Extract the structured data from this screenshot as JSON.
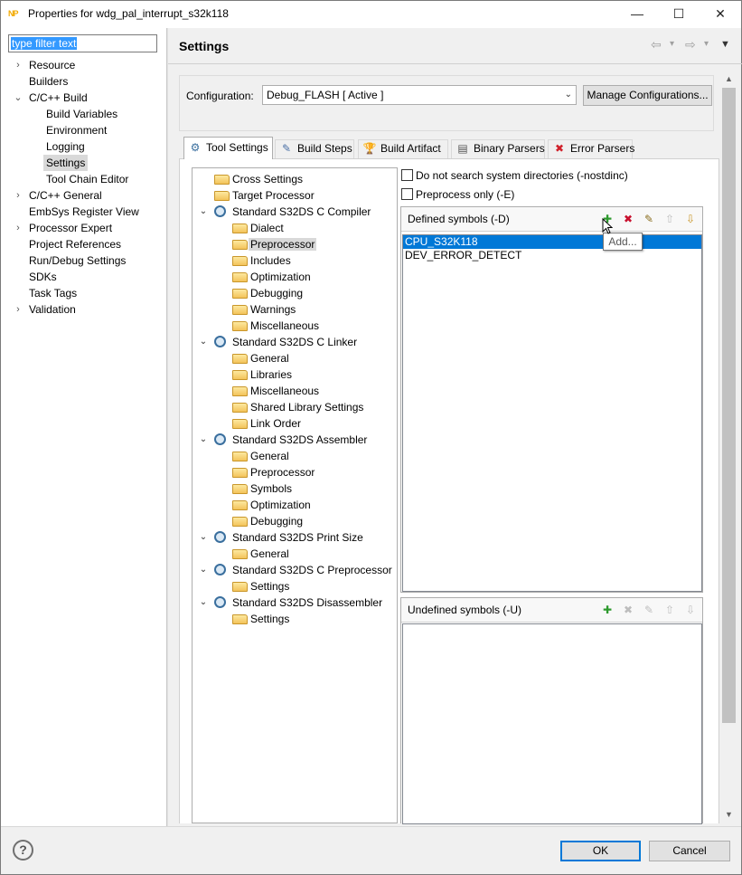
{
  "window": {
    "title": "Properties for wdg_pal_interrupt_s32k118",
    "logo": "NP",
    "controls": {
      "minimize": "—",
      "maximize": "☐",
      "close": "✕"
    }
  },
  "left_pane": {
    "filter_placeholder": "type filter text",
    "items": [
      {
        "label": "Resource",
        "chevron": "›"
      },
      {
        "label": "Builders",
        "chevron": ""
      },
      {
        "label": "C/C++ Build",
        "chevron": "⌄"
      },
      {
        "label": "Build Variables",
        "chevron": ""
      },
      {
        "label": "Environment",
        "chevron": ""
      },
      {
        "label": "Logging",
        "chevron": ""
      },
      {
        "label": "Settings",
        "chevron": ""
      },
      {
        "label": "Tool Chain Editor",
        "chevron": ""
      },
      {
        "label": "C/C++ General",
        "chevron": "›"
      },
      {
        "label": "EmbSys Register View",
        "chevron": ""
      },
      {
        "label": "Processor Expert",
        "chevron": "›"
      },
      {
        "label": "Project References",
        "chevron": ""
      },
      {
        "label": "Run/Debug Settings",
        "chevron": ""
      },
      {
        "label": "SDKs",
        "chevron": ""
      },
      {
        "label": "Task Tags",
        "chevron": ""
      },
      {
        "label": "Validation",
        "chevron": "›"
      }
    ]
  },
  "header": {
    "title": "Settings",
    "nav": {
      "back": "⇦",
      "back_menu": "▾",
      "forward": "⇨",
      "forward_menu": "▾",
      "view_menu": "▼"
    }
  },
  "configuration": {
    "label": "Configuration:",
    "value": "Debug_FLASH  [ Active ]",
    "dropdown_arrow": "⌄",
    "manage_button": "Manage Configurations..."
  },
  "tabs": [
    {
      "label": "Tool Settings",
      "icon": "tool-settings-icon",
      "glyph": "⚙"
    },
    {
      "label": "Build Steps",
      "icon": "build-steps-icon",
      "glyph": "✎"
    },
    {
      "label": "Build Artifact",
      "icon": "build-artifact-icon",
      "glyph": "🏆"
    },
    {
      "label": "Binary Parsers",
      "icon": "binary-parsers-icon",
      "glyph": "▤"
    },
    {
      "label": "Error Parsers",
      "icon": "error-parsers-icon",
      "glyph": "✖"
    }
  ],
  "tool_tree": [
    {
      "label": "Cross Settings"
    },
    {
      "label": "Target Processor"
    },
    {
      "label": "Standard S32DS C Compiler"
    },
    {
      "label": "Dialect"
    },
    {
      "label": "Preprocessor"
    },
    {
      "label": "Includes"
    },
    {
      "label": "Optimization"
    },
    {
      "label": "Debugging"
    },
    {
      "label": "Warnings"
    },
    {
      "label": "Miscellaneous"
    },
    {
      "label": "Standard S32DS C Linker"
    },
    {
      "label": "General"
    },
    {
      "label": "Libraries"
    },
    {
      "label": "Miscellaneous"
    },
    {
      "label": "Shared Library Settings"
    },
    {
      "label": "Link Order"
    },
    {
      "label": "Standard S32DS Assembler"
    },
    {
      "label": "General"
    },
    {
      "label": "Preprocessor"
    },
    {
      "label": "Symbols"
    },
    {
      "label": "Optimization"
    },
    {
      "label": "Debugging"
    },
    {
      "label": "Standard S32DS Print Size"
    },
    {
      "label": "General"
    },
    {
      "label": "Standard S32DS C Preprocessor"
    },
    {
      "label": "Settings"
    },
    {
      "label": "Standard S32DS Disassembler"
    },
    {
      "label": "Settings"
    }
  ],
  "options": {
    "nostdinc_label": "Do not search system directories (-nostdinc)",
    "preprocess_only_label": "Preprocess only (-E)"
  },
  "defined_symbols": {
    "title": "Defined symbols (-D)",
    "items": [
      "CPU_S32K118",
      "DEV_ERROR_DETECT"
    ],
    "tooltip": "Add..."
  },
  "undefined_symbols": {
    "title": "Undefined symbols (-U)",
    "items": []
  },
  "toolbar_glyphs": {
    "add": "✚",
    "delete": "✖",
    "edit": "✎",
    "up": "⇧",
    "down": "⇩"
  },
  "scrollbar": {
    "up": "▲",
    "down": "▼"
  },
  "footer": {
    "help": "?",
    "ok": "OK",
    "cancel": "Cancel"
  }
}
